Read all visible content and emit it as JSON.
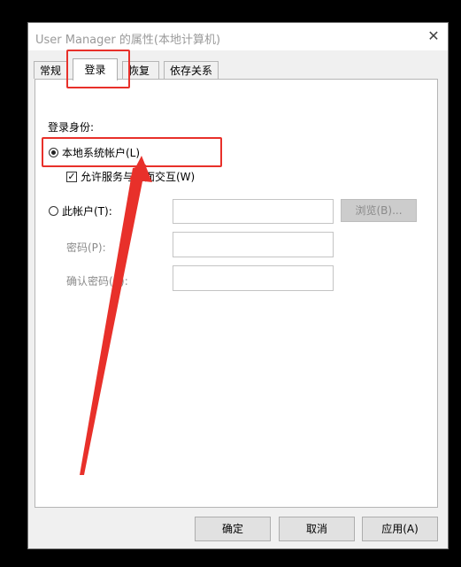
{
  "window": {
    "title": "User Manager 的属性(本地计算机)",
    "close_glyph": "✕"
  },
  "tabs": [
    {
      "label": "常规",
      "active": false
    },
    {
      "label": "登录",
      "active": true
    },
    {
      "label": "恢复",
      "active": false
    },
    {
      "label": "依存关系",
      "active": false
    }
  ],
  "logon": {
    "section_label": "登录身份:",
    "local_system_label": "本地系统帐户(L)",
    "local_system_checked": true,
    "interact_desktop_label": "允许服务与桌面交互(W)",
    "interact_desktop_checked": true,
    "this_account_label": "此帐户(T):",
    "this_account_checked": false,
    "account_value": "",
    "browse_label": "浏览(B)...",
    "password_label": "密码(P):",
    "password_value": "",
    "confirm_password_label": "确认密码(C):",
    "confirm_password_value": ""
  },
  "buttons": {
    "ok": "确定",
    "cancel": "取消",
    "apply": "应用(A)"
  },
  "annotation_color": "#e8302a"
}
